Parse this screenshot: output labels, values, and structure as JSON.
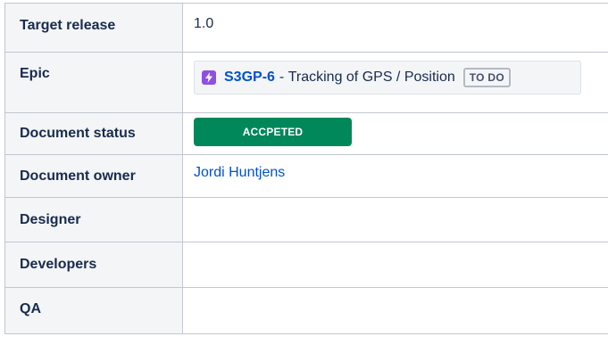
{
  "rows": [
    {
      "label": "Target release",
      "value": "1.0"
    },
    {
      "label": "Epic",
      "epic": {
        "key": "S3GP-6",
        "separator": "-",
        "summary": "Tracking of GPS / Position",
        "status": "TO DO",
        "icon": "lightning-bolt-icon",
        "icon_color": "#904ee2"
      }
    },
    {
      "label": "Document status",
      "status": "ACCPETED",
      "status_color": "#00875a"
    },
    {
      "label": "Document owner",
      "value": "Jordi Huntjens"
    },
    {
      "label": "Designer",
      "value": ""
    },
    {
      "label": "Developers",
      "value": ""
    },
    {
      "label": "QA",
      "value": ""
    }
  ],
  "colors": {
    "link": "#0052cc",
    "header_bg": "#f4f5f7",
    "border": "#c1c7d0"
  }
}
